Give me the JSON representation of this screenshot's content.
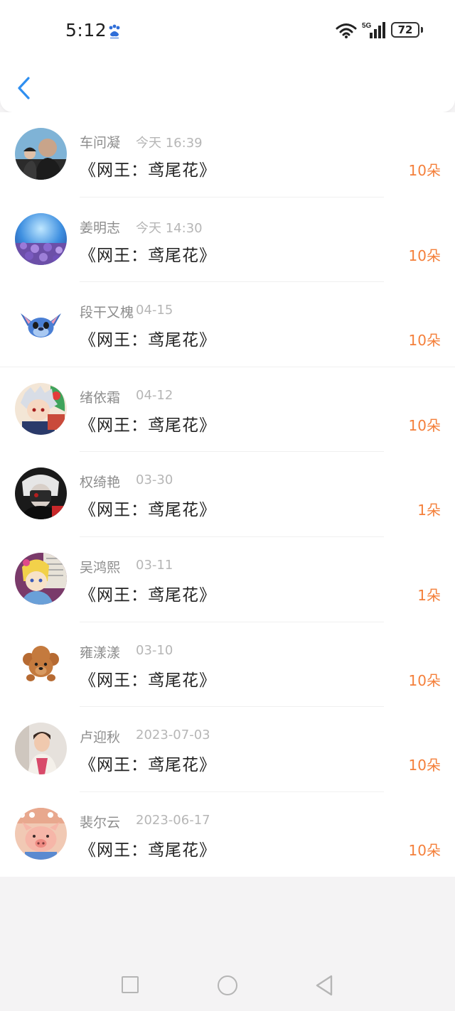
{
  "status_bar": {
    "time": "5:12",
    "network": "5G",
    "battery": "72"
  },
  "header": {
    "back_icon": "chevron-left-icon"
  },
  "colors": {
    "accent_blue": "#2f8ff0",
    "count_orange": "#f47f3a",
    "name_gray": "#8d8d8d",
    "time_gray": "#b6b6b6"
  },
  "records": [
    {
      "name": "车问凝",
      "time": "今天 16:39",
      "title": "《网王：鸢尾花》",
      "count": "10朵"
    },
    {
      "name": "姜明志",
      "time": "今天 14:30",
      "title": "《网王：鸢尾花》",
      "count": "10朵"
    },
    {
      "name": "段干又槐",
      "time": "04-15",
      "title": "《网王：鸢尾花》",
      "count": "10朵"
    },
    {
      "name": "绪依霜",
      "time": "04-12",
      "title": "《网王：鸢尾花》",
      "count": "10朵"
    },
    {
      "name": "权绮艳",
      "time": "03-30",
      "title": "《网王：鸢尾花》",
      "count": "1朵"
    },
    {
      "name": "吴鸿熙",
      "time": "03-11",
      "title": "《网王：鸢尾花》",
      "count": "1朵"
    },
    {
      "name": "雍漾漾",
      "time": "03-10",
      "title": "《网王：鸢尾花》",
      "count": "10朵"
    },
    {
      "name": "卢迎秋",
      "time": "2023-07-03",
      "title": "《网王：鸢尾花》",
      "count": "10朵"
    },
    {
      "name": "裴尔云",
      "time": "2023-06-17",
      "title": "《网王：鸢尾花》",
      "count": "10朵"
    }
  ],
  "nav": {
    "recent_icon": "square-icon",
    "home_icon": "circle-icon",
    "back_icon": "triangle-back-icon"
  }
}
